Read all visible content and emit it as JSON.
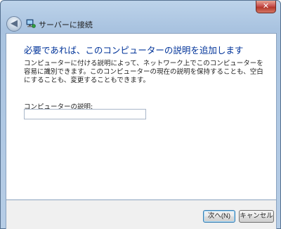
{
  "window": {
    "title": "サーバーに接続",
    "close_glyph": "✕",
    "back_glyph": "◀"
  },
  "content": {
    "heading": "必要であれば、このコンピューターの説明を追加します",
    "description": "コンピューターに付ける説明によって、ネットワーク上でこのコンピューターを容易に識別できます。このコンピューターの現在の説明を保持することも、空白にすることも、変更することもできます。",
    "field_label": "コンピューターの説明:",
    "field_value": "",
    "field_placeholder": ""
  },
  "footer": {
    "next_label": "次へ(N)",
    "cancel_label": "キャンセル"
  },
  "colors": {
    "heading": "#003399",
    "frame": "#a9c3e0"
  },
  "icons": {
    "app": "network-computer-icon",
    "back": "back-arrow-icon",
    "close": "close-icon"
  }
}
